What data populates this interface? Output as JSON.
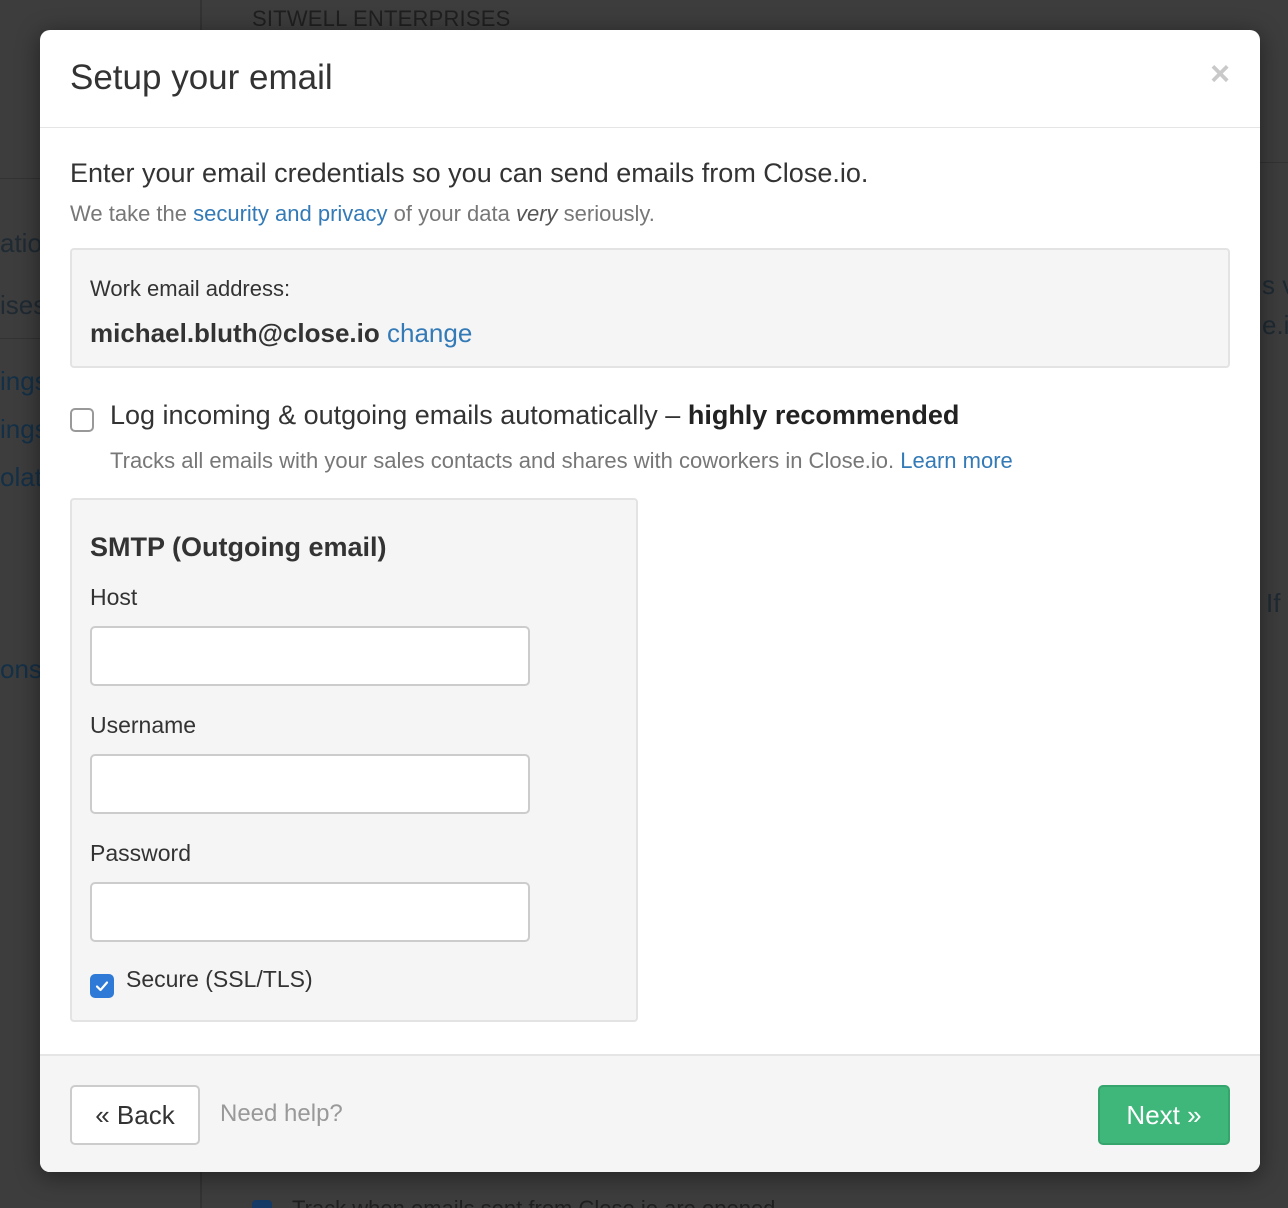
{
  "background": {
    "company": "SITWELL ENTERPRISES",
    "fragments": [
      "atio",
      "ises",
      "ings",
      "ings",
      "olate",
      "ons",
      "s v",
      "e.i",
      "If"
    ],
    "bottom_text": "Track when emails sent from Close.io are opened"
  },
  "modal": {
    "title": "Setup your email",
    "close_glyph": "×",
    "intro": {
      "main": "Enter your email credentials so you can send emails from Close.io.",
      "sub_prefix": "We take the ",
      "sub_link": "security and privacy",
      "sub_middle": " of your data ",
      "sub_emphasis": "very",
      "sub_suffix": " seriously."
    },
    "work_email": {
      "label": "Work email address:",
      "value": "michael.bluth@close.io",
      "change_link": "change"
    },
    "log_emails": {
      "checked": false,
      "label": "Log incoming & outgoing emails automatically – ",
      "label_strong": "highly recommended",
      "description": "Tracks all emails with your sales contacts and shares with coworkers in Close.io. ",
      "learn_more": "Learn more"
    },
    "smtp": {
      "title": "SMTP (Outgoing email)",
      "host_label": "Host",
      "host_value": "",
      "username_label": "Username",
      "username_value": "",
      "password_label": "Password",
      "password_value": "",
      "secure_label": "Secure (SSL/TLS)",
      "secure_checked": true
    },
    "footer": {
      "back_label": "« Back",
      "help_label": "Need help?",
      "next_label": "Next »"
    }
  },
  "colors": {
    "link": "#337ab7",
    "primary_green": "#3fb67a",
    "checkbox_blue": "#2f7ad6"
  }
}
